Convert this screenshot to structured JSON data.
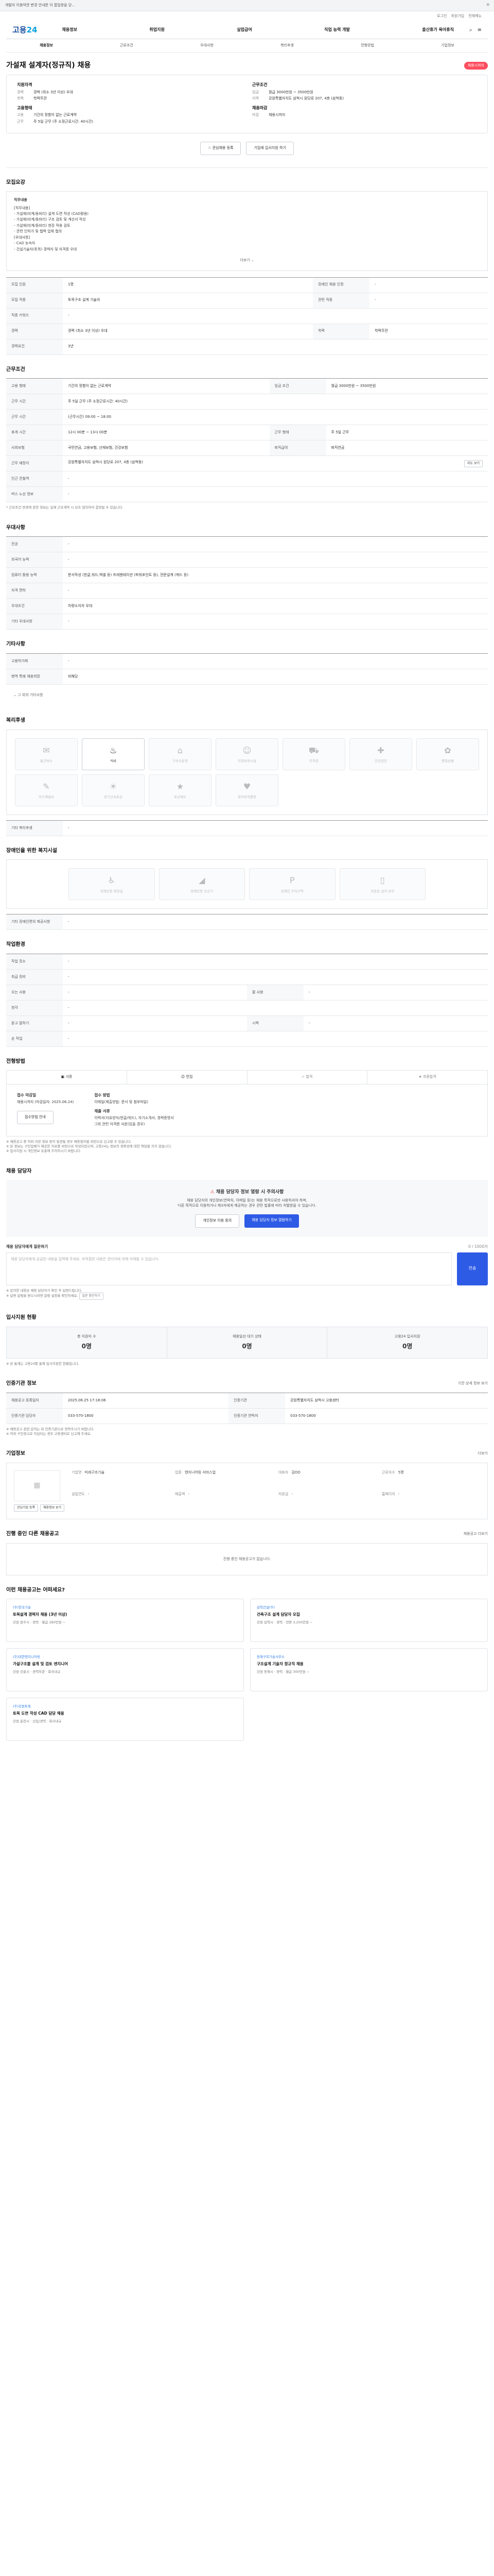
{
  "topbar": {
    "text": "개발자 이용약관 변경 안내문 이 팝업창을 닫..."
  },
  "util": {
    "items": [
      "로그인",
      "회원가입",
      "전체메뉴"
    ]
  },
  "logo": {
    "main": "고용",
    "accent": "24"
  },
  "gnb": {
    "items": [
      "채용정보",
      "취업지원",
      "실업급여",
      "직업 능력 개발",
      "출산휴가 육아휴직"
    ]
  },
  "tabs": {
    "items": [
      "채용정보",
      "근로조건",
      "우대사항",
      "복리후생",
      "전형방법",
      "기업정보"
    ]
  },
  "job": {
    "title": "가설재 설계자(정규직) 채용",
    "badge": "채용시까지"
  },
  "summary": {
    "left_head1": "지원자격",
    "left_rows": [
      {
        "k": "경력",
        "v": "경력 (최소 3년 이상) 우대"
      },
      {
        "k": "학력",
        "v": "학력무관"
      }
    ],
    "left_head2": "고용형태",
    "left_rows2": [
      {
        "k": "고용",
        "v": "기간의 정함이 없는 근로계약"
      },
      {
        "k": "근무",
        "v": "주 5일 근무 (주 소정근로시간: 40시간)"
      }
    ],
    "right_head1": "근무조건",
    "right_rows": [
      {
        "k": "임금",
        "v": "월급 3000만원 ~ 3500만원"
      },
      {
        "k": "지역",
        "v": "강원특별자치도 삼척시 원당로 207, 4층 (삼척동)"
      }
    ],
    "right_head2": "채용마감",
    "right_rows2": [
      {
        "k": "마감",
        "v": "채용시까지"
      }
    ]
  },
  "buttons": {
    "scrap": "관심채용 등록",
    "apply": "기업에 입사지원 하기"
  },
  "recruit": {
    "section": "모집요강",
    "desc_title": "직무내용",
    "desc_lines": [
      "[직무내용]",
      "- 가설재(비계/동바리) 설계 도면 작성 (CAD활용)",
      "- 가설재(비계/동바리) 구조 검토 및 계산서 작성",
      "- 가설재(비계/동바리) 현장 적용 검토",
      "- 관련 인허가 및 협력 업체 협의",
      "[우대사항]",
      "- CAD 능숙자",
      "- 건설기술자(토목) 경력자 및 자격증 우대"
    ],
    "more": "더보기",
    "rows": [
      {
        "k": "모집 인원",
        "v": "1명",
        "k2": "장애인 채용 인정",
        "v2": "-"
      },
      {
        "k": "모집 직종",
        "v": "토목구조 설계 기술자",
        "k2": "관련 직종",
        "v2": "-"
      },
      {
        "k": "직종 키워드",
        "v": "-",
        "k2": "",
        "v2": ""
      },
      {
        "k": "경력",
        "v": "경력 (최소 3년 이상) 우대",
        "k2": "학력",
        "v2": "학력무관"
      },
      {
        "k": "경력요건",
        "v": "3년",
        "k2": "",
        "v2": ""
      }
    ]
  },
  "work": {
    "section": "근무조건",
    "rows": [
      {
        "k": "고용 형태",
        "v": "기간의 정함이 없는 근로계약",
        "k2": "임금 조건",
        "v2": "월급 3000만원 ~ 3500만원"
      },
      {
        "k": "근무 시간",
        "v": "주 5일 근무 (주 소정근로시간: 40시간)",
        "k2": "",
        "v2": ""
      },
      {
        "k": "근무 시간",
        "v": "(근무시간) 09:00 ~ 18:00",
        "k2": "",
        "v2": ""
      },
      {
        "k": "휴게 시간",
        "v": "12시 00분 ~ 13시 00분",
        "k2": "근무 형태",
        "v2": "주 5일 근무"
      },
      {
        "k": "사회보험",
        "v": "국민연금, 고용보험, 산재보험, 건강보험",
        "k2": "퇴직급여",
        "v2": "퇴직연금"
      },
      {
        "k": "근무 예정지",
        "v": "강원특별자치도 삼척시 원당로 207, 4층 (삼척동)",
        "k2": "",
        "v2": ""
      },
      {
        "k": "인근 전철역",
        "v": "-",
        "k2": "",
        "v2": ""
      },
      {
        "k": "버스 노선 정보",
        "v": "-",
        "k2": "",
        "v2": ""
      }
    ],
    "map_btn": "지도 보기",
    "note": "* 근로조건 변경에 관한 정보는 실제 근로계약 시 상호 협의하여 결정될 수 있습니다."
  },
  "pref": {
    "section": "우대사항",
    "rows": [
      {
        "k": "전공",
        "v": "-"
      },
      {
        "k": "외국어 능력",
        "v": "-"
      },
      {
        "k": "컴퓨터 활용 능력",
        "v": "문서작성 (한글,워드,엑셀 등) 프레젠테이션 (파워포인트 등), 전문설계 (캐드 등)"
      },
      {
        "k": "자격 면허",
        "v": "-"
      },
      {
        "k": "우대조건",
        "v": "차량소지자 우대"
      },
      {
        "k": "기타 우대사항",
        "v": "-"
      }
    ]
  },
  "etc": {
    "section": "기타사항",
    "rows": [
      {
        "k": "고용허가제",
        "v": "-"
      },
      {
        "k": "병역 특례 채용희망",
        "v": "비해당"
      }
    ],
    "foot": "그 외의 기타사항"
  },
  "benefit": {
    "section": "복리후생",
    "items": [
      {
        "icon": "briefcase-icon",
        "glyph": "✉",
        "label": "통근버스",
        "on": false
      },
      {
        "icon": "meal-icon",
        "glyph": "♨",
        "label": "식비",
        "on": true
      },
      {
        "icon": "house-icon",
        "glyph": "⌂",
        "label": "기숙사운영",
        "on": false
      },
      {
        "icon": "child-icon",
        "glyph": "☺",
        "label": "직장보육시설",
        "on": false
      },
      {
        "icon": "car-icon",
        "glyph": "⛟",
        "label": "주차장",
        "on": false
      },
      {
        "icon": "health-icon",
        "glyph": "✚",
        "label": "건강검진",
        "on": false
      },
      {
        "icon": "gift-icon",
        "glyph": "✿",
        "label": "명절선물",
        "on": false
      },
      {
        "icon": "edu-icon",
        "glyph": "✎",
        "label": "자기계발비",
        "on": false
      },
      {
        "icon": "calendar-icon",
        "glyph": "☀",
        "label": "장기근속포상",
        "on": false
      },
      {
        "icon": "award-icon",
        "glyph": "★",
        "label": "포상제도",
        "on": false
      },
      {
        "icon": "family-icon",
        "glyph": "♥",
        "label": "육아휴직활용",
        "on": false
      }
    ],
    "foot_label": "기타 복리후생",
    "foot_value": "-"
  },
  "disability": {
    "section": "장애인을 위한 복지시설",
    "items": [
      {
        "icon": "wheelchair-icon",
        "glyph": "♿",
        "label": "장애인용 화장실"
      },
      {
        "icon": "ramp-icon",
        "glyph": "◢",
        "label": "장애인용 승강기"
      },
      {
        "icon": "parking-icon",
        "glyph": "P",
        "label": "장애인 주차구역"
      },
      {
        "icon": "door-icon",
        "glyph": "▯",
        "label": "자동문 설치 유무"
      }
    ],
    "foot_label": "기타 장애인편의 제공사항",
    "foot_value": "-"
  },
  "workplace": {
    "section": "작업환경",
    "rows": [
      {
        "k": "작업 장소",
        "v": "-",
        "k2": "",
        "v2": ""
      },
      {
        "k": "취급 장비",
        "v": "-",
        "k2": "",
        "v2": ""
      },
      {
        "k": "오는 사용",
        "v": "-",
        "k2": "팔 사용",
        "v2": "-"
      },
      {
        "k": "청각",
        "v": "-",
        "k2": "",
        "v2": ""
      },
      {
        "k": "듣고 말하기",
        "v": "-",
        "k2": "시력",
        "v2": "-"
      },
      {
        "k": "손 작업",
        "v": "-",
        "k2": "",
        "v2": ""
      }
    ]
  },
  "process": {
    "section": "전형방법",
    "steps": [
      "서류",
      "면접",
      "합격",
      "최종합격"
    ]
  },
  "apply": {
    "col1_head": "접수 마감일",
    "col1_lines": [
      "채용시까지 (마감일자: 2025.06.24)"
    ],
    "col1_btn": "접수방법 안내",
    "col2_head": "접수 방법",
    "col2_lines": [
      "이메일(제출방법: 문서 및 첨부파일)"
    ],
    "col3_head": "제출 서류",
    "col3_lines": [
      "이력서(자유양식/한글/워드), 자기소개서, 경력증명서",
      "그외 관련 자격증 사본(있을 경우)"
    ],
    "notes": [
      "※ 채용공고 중 허위·과장 정보 등이 발견될 경우 채용절차법 위반으로 신고할 수 있습니다.",
      "※ 본 정보는 구인업체가 제공한 자료를 바탕으로 작성되었으며, 고용24는 정보의 정확성에 대한 책임을 지지 않습니다.",
      "※ 입사지원 시 개인정보 유출에 주의하시기 바랍니다."
    ]
  },
  "manager": {
    "section": "채용 담당자",
    "notice_title": "채용 담당자 정보 열람 시 주의사항",
    "notice_lines": [
      "채용 담당자의 개인정보(연락처, 이메일 등)는 채용 목적으로만 사용하셔야 하며,",
      "다른 목적으로 이용하거나 제3자에게 제공하는 경우 관련 법률에 따라 처벌받을 수 있습니다."
    ],
    "btn1": "개인정보 이용 동의",
    "btn2": "채용 담당자 정보 열람하기",
    "inquiry_label": "채용 담당자에게 질문하기",
    "inquiry_counter": "0 / 1000자",
    "inquiry_placeholder": "채용 담당자에게 궁금한 내용을 입력해 주세요. 부적절한 내용은 관리자에 의해 삭제될 수 있습니다.",
    "send": "전송",
    "notes": [
      "※ 문의한 내용은 채용 담당자가 확인 후 답변드립니다.",
      "※ 답변 알림을 받으시려면 알림 설정을 확인하세요."
    ],
    "notes_btn": "질문 확인하기"
  },
  "stats": {
    "section": "입사지원 현황",
    "items": [
      {
        "label": "총 지원자 수",
        "value": "0명"
      },
      {
        "label": "채용일선 대기 상태",
        "value": "0명"
      },
      {
        "label": "고용24 입사지원",
        "value": "0명"
      }
    ],
    "note": "※ 본 통계는 고용24를 통해 입사지원한 현황입니다."
  },
  "info": {
    "section": "인증기관 정보",
    "side": "기관 상세 정보 보기",
    "rows": [
      {
        "k": "채용공고 등록일자",
        "v": "2025.06.25 17:18:06",
        "k2": "인증기관",
        "v2": "강원특별자치도 삼척시 고용센터"
      },
      {
        "k": "인증기관 담당자",
        "v": "033-570-1800",
        "k2": "인증기관 연락처",
        "v2": "033-570-1800"
      }
    ],
    "notes": [
      "※ 채용공고 관련 문의는 위 인증기관으로 연락주시기 바랍니다.",
      "※ 허위 구인광고로 의심되는 경우 고용센터로 신고해 주세요."
    ]
  },
  "company": {
    "section": "기업정보",
    "side": "더보기",
    "logo_glyph": "▦",
    "rows": [
      {
        "k": "기업명",
        "v": "미래구조기술"
      },
      {
        "k": "업종",
        "v": "엔지니어링 서비스업"
      },
      {
        "k": "대표자",
        "v": "김OO"
      },
      {
        "k": "근로자수",
        "v": "5명"
      },
      {
        "k": "설립연도",
        "v": "-"
      },
      {
        "k": "매출액",
        "v": "-"
      },
      {
        "k": "자본금",
        "v": "-"
      },
      {
        "k": "홈페이지",
        "v": "-"
      }
    ],
    "btn1": "관심기업 등록",
    "btn2": "채용정보 보기"
  },
  "similar": {
    "section": "진행 중인 다른 채용공고",
    "side": "채용공고 더보기",
    "empty": "진행 중인 채용공고가 없습니다."
  },
  "recommend": {
    "section": "이런 채용공고는 어떠세요?",
    "items": [
      {
        "company": "(주)한국기술",
        "title": "토목설계 경력자 채용 (3년 이상)",
        "meta": "강원 원주시 · 경력 · 월급 280만원 ~"
      },
      {
        "company": "삼척건설(주)",
        "title": "건축구조 설계 담당자 모집",
        "meta": "강원 삼척시 · 경력 · 연봉 3,200만원 ~"
      },
      {
        "company": "(주)대한엔지니어링",
        "title": "가설구조물 설계 및 검토 엔지니어",
        "meta": "강원 강릉시 · 경력무관 · 회사내규"
      },
      {
        "company": "동해구조기술사무소",
        "title": "구조설계 기술자 정규직 채용",
        "meta": "강원 동해시 · 경력 · 월급 300만원 ~"
      },
      {
        "company": "(주)강원토목",
        "title": "토목 도면 작성 CAD 담당 채용",
        "meta": "강원 춘천시 · 신입/경력 · 회사내규"
      }
    ]
  }
}
